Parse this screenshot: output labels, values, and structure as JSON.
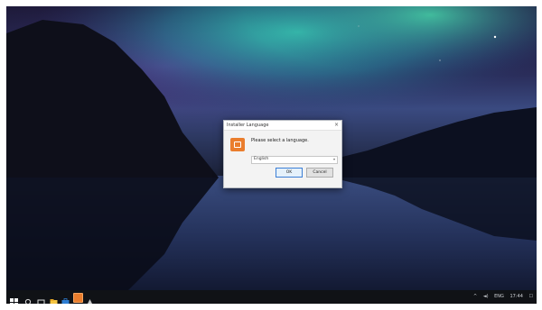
{
  "dialog": {
    "title": "Installer Language",
    "prompt": "Please select a language.",
    "selected_language": "English",
    "ok_label": "OK",
    "cancel_label": "Cancel",
    "close_glyph": "×"
  },
  "taskbar": {
    "icons": [
      "start-icon",
      "search-icon",
      "task-view-icon",
      "file-explorer-icon",
      "store-icon",
      "installer-icon",
      "app-icon"
    ],
    "tray": {
      "arrow": "^",
      "volume": "◄)",
      "lang": "ENG",
      "time": "17:44",
      "notification": "☐"
    }
  },
  "colors": {
    "accent": "#3c7fd6",
    "installer_icon": "#ea7d2d"
  }
}
